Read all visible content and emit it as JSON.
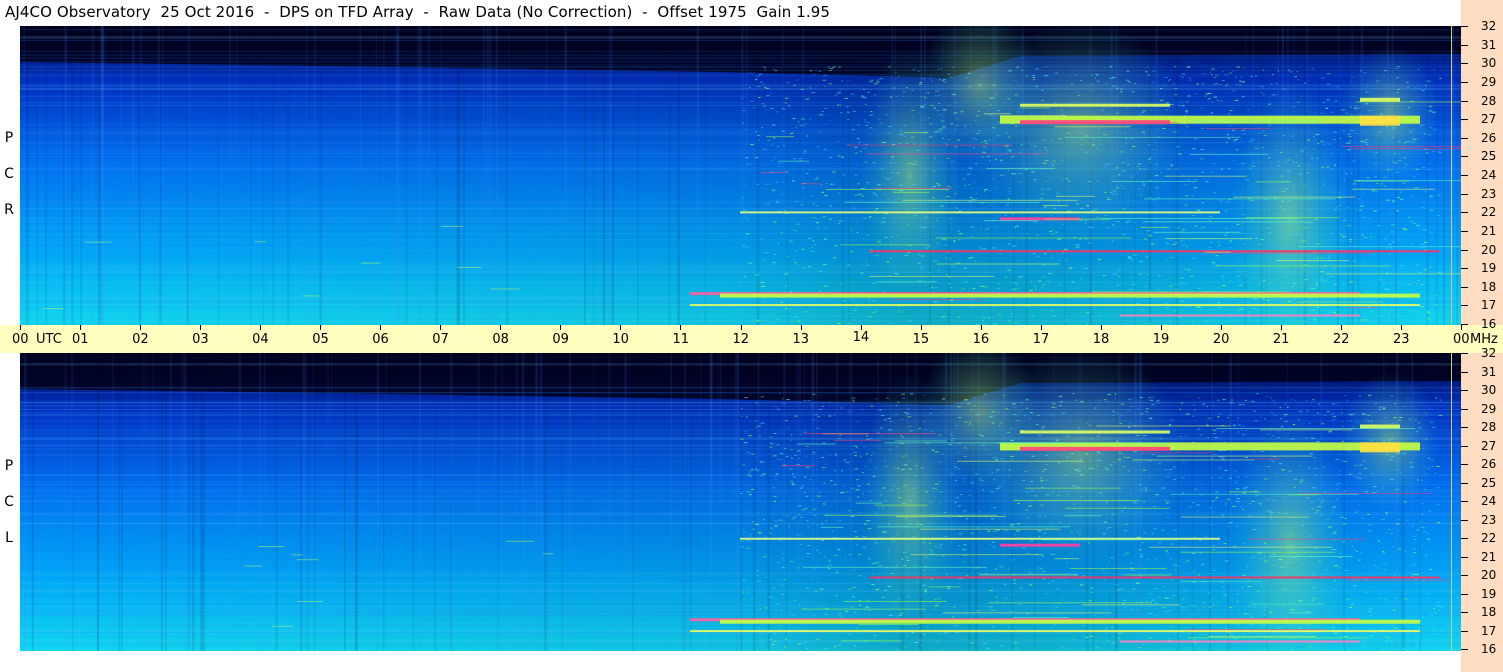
{
  "title": "AJ4CO Observatory  25 Oct 2016  -  DPS on TFD Array  -  Raw Data (No Correction)  -  Offset 1975  Gain 1.95",
  "colors": {
    "right_strip": "#ffddc2",
    "time_axis_bg": "#ffffc0",
    "spectrogram_low": "#000018",
    "spectrogram_mid": "#0060e0",
    "spectrogram_high": "#ffff60"
  },
  "chart_data": [
    {
      "type": "heatmap",
      "panel": "RCP",
      "side_label": [
        "R",
        "C",
        "P"
      ],
      "title": "",
      "xlabel": "UTC",
      "ylabel": "MHz",
      "x_ticks": [
        "00",
        "01",
        "02",
        "03",
        "04",
        "05",
        "06",
        "07",
        "08",
        "09",
        "10",
        "11",
        "12",
        "13",
        "14",
        "15",
        "16",
        "17",
        "18",
        "19",
        "20",
        "21",
        "22",
        "23",
        "00"
      ],
      "y_ticks": [
        "32",
        "31",
        "30",
        "29",
        "28",
        "27",
        "26",
        "25",
        "24",
        "23",
        "22",
        "21",
        "20",
        "19",
        "18",
        "17",
        "16"
      ],
      "xlim": [
        0,
        24
      ],
      "ylim": [
        16,
        32
      ],
      "grid": false
    },
    {
      "type": "heatmap",
      "panel": "LCP",
      "side_label": [
        "L",
        "C",
        "P"
      ],
      "title": "",
      "xlabel": "UTC",
      "ylabel": "MHz",
      "x_ticks": [
        "00",
        "01",
        "02",
        "03",
        "04",
        "05",
        "06",
        "07",
        "08",
        "09",
        "10",
        "11",
        "12",
        "13",
        "14",
        "15",
        "16",
        "17",
        "18",
        "19",
        "20",
        "21",
        "22",
        "23",
        "00"
      ],
      "y_ticks": [
        "32",
        "31",
        "30",
        "29",
        "28",
        "27",
        "26",
        "25",
        "24",
        "23",
        "22",
        "21",
        "20",
        "19",
        "18",
        "17",
        "16"
      ],
      "xlim": [
        0,
        24
      ],
      "ylim": [
        16,
        32
      ],
      "grid": false
    }
  ],
  "axis": {
    "utc_label": "UTC",
    "mhz_label": "MHz"
  }
}
